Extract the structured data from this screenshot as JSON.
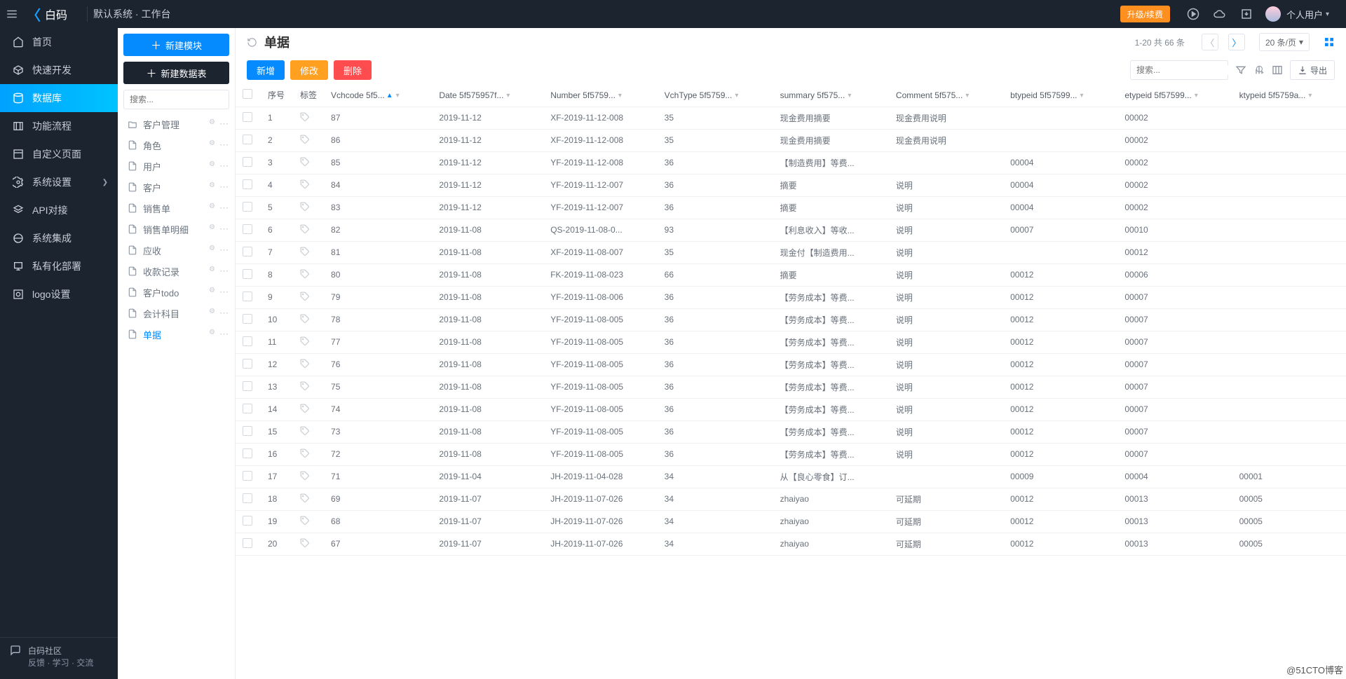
{
  "header": {
    "brand_text": "白码",
    "breadcrumb": "默认系统 · 工作台",
    "upgrade": "升级/续费",
    "user_tag": "个人用户",
    "chevron": "▾"
  },
  "sidebar": {
    "items": [
      {
        "label": "首页",
        "active": false
      },
      {
        "label": "快速开发",
        "active": false
      },
      {
        "label": "数据库",
        "active": true
      },
      {
        "label": "功能流程",
        "active": false
      },
      {
        "label": "自定义页面",
        "active": false
      },
      {
        "label": "系统设置",
        "active": false,
        "arrow": true
      },
      {
        "label": "API对接",
        "active": false
      },
      {
        "label": "系统集成",
        "active": false
      },
      {
        "label": "私有化部署",
        "active": false
      },
      {
        "label": "logo设置",
        "active": false
      }
    ],
    "bottom": {
      "title": "白码社区",
      "sub": "反馈 · 学习 · 交流"
    }
  },
  "panel2": {
    "btn1": "新建模块",
    "btn2": "新建数据表",
    "search_placeholder": "搜索...",
    "tree": [
      {
        "type": "folder",
        "label": "客户管理"
      },
      {
        "type": "file",
        "label": "角色"
      },
      {
        "type": "file",
        "label": "用户"
      },
      {
        "type": "file",
        "label": "客户"
      },
      {
        "type": "file",
        "label": "销售单"
      },
      {
        "type": "file",
        "label": "销售单明细"
      },
      {
        "type": "file",
        "label": "应收"
      },
      {
        "type": "file",
        "label": "收款记录"
      },
      {
        "type": "file",
        "label": "客户todo"
      },
      {
        "type": "file",
        "label": "会计科目"
      },
      {
        "type": "file",
        "label": "单据",
        "active": true
      }
    ]
  },
  "main": {
    "title": "单据",
    "page_stat": "1-20 共 66 条",
    "rpp": "20 条/页",
    "buttons": {
      "add": "新增",
      "edit": "修改",
      "del": "删除"
    },
    "search_placeholder": "搜索...",
    "export": "导出",
    "columns": [
      "序号",
      "标签",
      "Vchcode 5f5...",
      "Date 5f575957f...",
      "Number 5f5759...",
      "VchType 5f5759...",
      "summary 5f575...",
      "Comment 5f575...",
      "btypeid 5f57599...",
      "etypeid 5f57599...",
      "ktypeid 5f5759a..."
    ],
    "rows": [
      {
        "n": 1,
        "vch": "87",
        "date": "2019-11-12",
        "num": "XF-2019-11-12-008",
        "vt": "35",
        "sum": "现金费用摘要",
        "com": "现金费用说明",
        "b": "",
        "e": "00002",
        "k": ""
      },
      {
        "n": 2,
        "vch": "86",
        "date": "2019-11-12",
        "num": "XF-2019-11-12-008",
        "vt": "35",
        "sum": "现金费用摘要",
        "com": "现金费用说明",
        "b": "",
        "e": "00002",
        "k": ""
      },
      {
        "n": 3,
        "vch": "85",
        "date": "2019-11-12",
        "num": "YF-2019-11-12-008",
        "vt": "36",
        "sum": "【制造费用】等费...",
        "com": "",
        "b": "00004",
        "e": "00002",
        "k": ""
      },
      {
        "n": 4,
        "vch": "84",
        "date": "2019-11-12",
        "num": "YF-2019-11-12-007",
        "vt": "36",
        "sum": "摘要",
        "com": "说明",
        "b": "00004",
        "e": "00002",
        "k": ""
      },
      {
        "n": 5,
        "vch": "83",
        "date": "2019-11-12",
        "num": "YF-2019-11-12-007",
        "vt": "36",
        "sum": "摘要",
        "com": "说明",
        "b": "00004",
        "e": "00002",
        "k": ""
      },
      {
        "n": 6,
        "vch": "82",
        "date": "2019-11-08",
        "num": "QS-2019-11-08-0...",
        "vt": "93",
        "sum": "【利息收入】等收...",
        "com": "说明",
        "b": "00007",
        "e": "00010",
        "k": ""
      },
      {
        "n": 7,
        "vch": "81",
        "date": "2019-11-08",
        "num": "XF-2019-11-08-007",
        "vt": "35",
        "sum": "现金付【制造费用...",
        "com": "说明",
        "b": "",
        "e": "00012",
        "k": ""
      },
      {
        "n": 8,
        "vch": "80",
        "date": "2019-11-08",
        "num": "FK-2019-11-08-023",
        "vt": "66",
        "sum": "摘要",
        "com": "说明",
        "b": "00012",
        "e": "00006",
        "k": ""
      },
      {
        "n": 9,
        "vch": "79",
        "date": "2019-11-08",
        "num": "YF-2019-11-08-006",
        "vt": "36",
        "sum": "【劳务成本】等费...",
        "com": "说明",
        "b": "00012",
        "e": "00007",
        "k": ""
      },
      {
        "n": 10,
        "vch": "78",
        "date": "2019-11-08",
        "num": "YF-2019-11-08-005",
        "vt": "36",
        "sum": "【劳务成本】等费...",
        "com": "说明",
        "b": "00012",
        "e": "00007",
        "k": ""
      },
      {
        "n": 11,
        "vch": "77",
        "date": "2019-11-08",
        "num": "YF-2019-11-08-005",
        "vt": "36",
        "sum": "【劳务成本】等费...",
        "com": "说明",
        "b": "00012",
        "e": "00007",
        "k": ""
      },
      {
        "n": 12,
        "vch": "76",
        "date": "2019-11-08",
        "num": "YF-2019-11-08-005",
        "vt": "36",
        "sum": "【劳务成本】等费...",
        "com": "说明",
        "b": "00012",
        "e": "00007",
        "k": ""
      },
      {
        "n": 13,
        "vch": "75",
        "date": "2019-11-08",
        "num": "YF-2019-11-08-005",
        "vt": "36",
        "sum": "【劳务成本】等费...",
        "com": "说明",
        "b": "00012",
        "e": "00007",
        "k": ""
      },
      {
        "n": 14,
        "vch": "74",
        "date": "2019-11-08",
        "num": "YF-2019-11-08-005",
        "vt": "36",
        "sum": "【劳务成本】等费...",
        "com": "说明",
        "b": "00012",
        "e": "00007",
        "k": ""
      },
      {
        "n": 15,
        "vch": "73",
        "date": "2019-11-08",
        "num": "YF-2019-11-08-005",
        "vt": "36",
        "sum": "【劳务成本】等费...",
        "com": "说明",
        "b": "00012",
        "e": "00007",
        "k": ""
      },
      {
        "n": 16,
        "vch": "72",
        "date": "2019-11-08",
        "num": "YF-2019-11-08-005",
        "vt": "36",
        "sum": "【劳务成本】等费...",
        "com": "说明",
        "b": "00012",
        "e": "00007",
        "k": ""
      },
      {
        "n": 17,
        "vch": "71",
        "date": "2019-11-04",
        "num": "JH-2019-11-04-028",
        "vt": "34",
        "sum": "从【良心零食】订...",
        "com": "",
        "b": "00009",
        "e": "00004",
        "k": "00001"
      },
      {
        "n": 18,
        "vch": "69",
        "date": "2019-11-07",
        "num": "JH-2019-11-07-026",
        "vt": "34",
        "sum": "zhaiyao",
        "com": "可延期",
        "b": "00012",
        "e": "00013",
        "k": "00005"
      },
      {
        "n": 19,
        "vch": "68",
        "date": "2019-11-07",
        "num": "JH-2019-11-07-026",
        "vt": "34",
        "sum": "zhaiyao",
        "com": "可延期",
        "b": "00012",
        "e": "00013",
        "k": "00005"
      },
      {
        "n": 20,
        "vch": "67",
        "date": "2019-11-07",
        "num": "JH-2019-11-07-026",
        "vt": "34",
        "sum": "zhaiyao",
        "com": "可延期",
        "b": "00012",
        "e": "00013",
        "k": "00005"
      }
    ]
  },
  "watermark": "@51CTO博客"
}
